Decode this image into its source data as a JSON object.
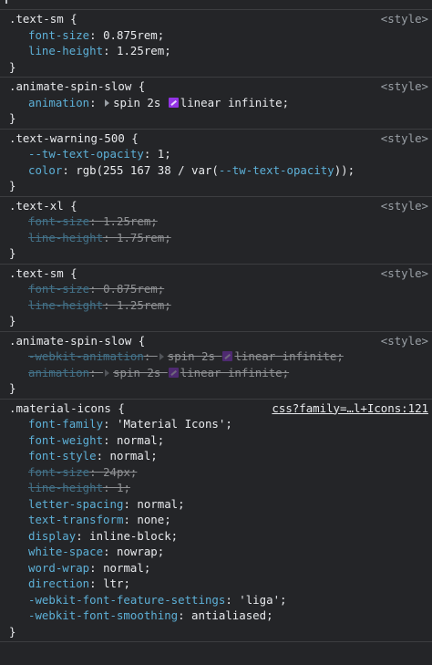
{
  "rules": [
    {
      "selector": ".text-sm {",
      "source": "<style>",
      "decls": [
        {
          "prop": "font-size",
          "val": "0.875rem",
          "strike": false
        },
        {
          "prop": "line-height",
          "val": "1.25rem",
          "strike": false
        }
      ]
    },
    {
      "selector": ".animate-spin-slow {",
      "source": "<style>",
      "decls": [
        {
          "prop": "animation",
          "val_pre": "spin 2s ",
          "val_post": "linear infinite",
          "strike": false,
          "expand": true,
          "easing": true
        }
      ]
    },
    {
      "selector": ".text-warning-500 {",
      "source": "<style>",
      "decls": [
        {
          "prop": "--tw-text-opacity",
          "val": "1",
          "strike": false
        },
        {
          "prop": "color",
          "val_pre": "rgb(255 167 38 / var(",
          "var": "--tw-text-opacity",
          "val_post": "))",
          "strike": false
        }
      ]
    },
    {
      "selector": ".text-xl {",
      "source": "<style>",
      "decls": [
        {
          "prop": "font-size",
          "val": "1.25rem",
          "strike": true
        },
        {
          "prop": "line-height",
          "val": "1.75rem",
          "strike": true
        }
      ]
    },
    {
      "selector": ".text-sm {",
      "source": "<style>",
      "decls": [
        {
          "prop": "font-size",
          "val": "0.875rem",
          "strike": true
        },
        {
          "prop": "line-height",
          "val": "1.25rem",
          "strike": true
        }
      ]
    },
    {
      "selector": ".animate-spin-slow {",
      "source": "<style>",
      "decls": [
        {
          "prop": "-webkit-animation",
          "val_pre": "spin 2s ",
          "val_post": "linear infinite",
          "strike": true,
          "expand": true,
          "easing": true
        },
        {
          "prop": "animation",
          "val_pre": "spin 2s ",
          "val_post": "linear infinite",
          "strike": true,
          "expand": true,
          "easing": true
        }
      ]
    },
    {
      "selector": ".material-icons {",
      "source": "css?family=…l+Icons:121",
      "source_link": true,
      "decls": [
        {
          "prop": "font-family",
          "val": "'Material Icons'",
          "strike": false
        },
        {
          "prop": "font-weight",
          "val": "normal",
          "strike": false
        },
        {
          "prop": "font-style",
          "val": "normal",
          "strike": false
        },
        {
          "prop": "font-size",
          "val": "24px",
          "strike": true
        },
        {
          "prop": "line-height",
          "val": "1",
          "strike": true
        },
        {
          "prop": "letter-spacing",
          "val": "normal",
          "strike": false
        },
        {
          "prop": "text-transform",
          "val": "none",
          "strike": false
        },
        {
          "prop": "display",
          "val": "inline-block",
          "strike": false
        },
        {
          "prop": "white-space",
          "val": "nowrap",
          "strike": false
        },
        {
          "prop": "word-wrap",
          "val": "normal",
          "strike": false
        },
        {
          "prop": "direction",
          "val": "ltr",
          "strike": false
        },
        {
          "prop": "-webkit-font-feature-settings",
          "val": "'liga'",
          "strike": false
        },
        {
          "prop": "-webkit-font-smoothing",
          "val": "antialiased",
          "strike": false
        }
      ]
    }
  ],
  "close_brace": "}"
}
